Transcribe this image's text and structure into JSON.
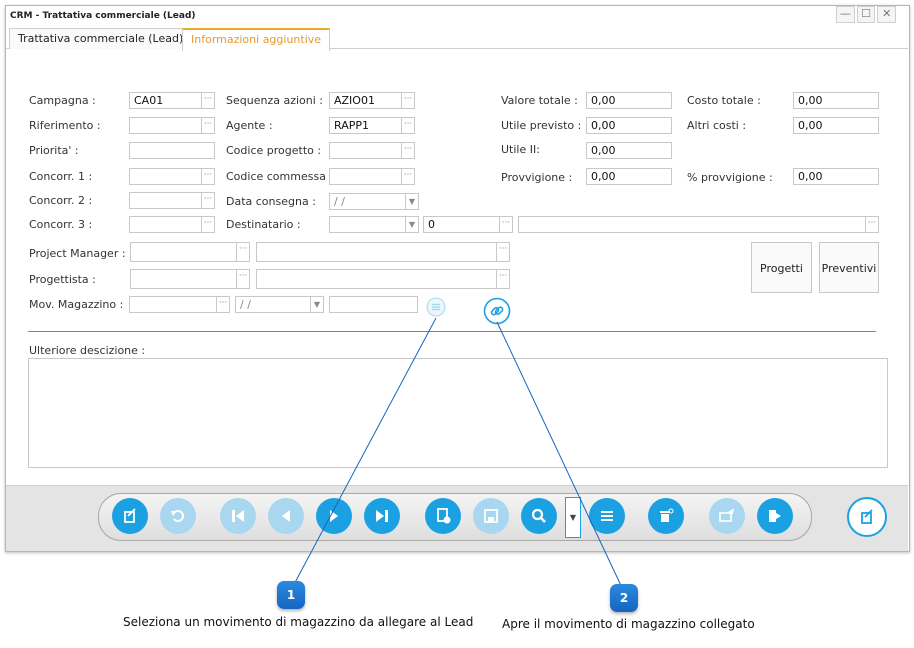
{
  "window": {
    "title": "CRM - Trattativa commerciale (Lead)",
    "controls": [
      "—",
      "☐",
      "✕"
    ]
  },
  "tabs": [
    {
      "label": "Trattativa commerciale (Lead)",
      "active": false
    },
    {
      "label": "Informazioni aggiuntive",
      "active": true
    }
  ],
  "form": {
    "campagna": {
      "label": "Campagna :",
      "value": "CA01"
    },
    "riferimento": {
      "label": "Riferimento :",
      "value": ""
    },
    "priorita": {
      "label": "Priorita' :",
      "value": ""
    },
    "concorr1": {
      "label": "Concorr. 1 :",
      "value": ""
    },
    "concorr2": {
      "label": "Concorr. 2 :",
      "value": ""
    },
    "concorr3": {
      "label": "Concorr. 3 :",
      "value": ""
    },
    "sequenza_azioni": {
      "label": "Sequenza azioni :",
      "value": "AZIO01"
    },
    "agente": {
      "label": "Agente :",
      "value": "RAPP1"
    },
    "codice_progetto": {
      "label": "Codice progetto :",
      "value": ""
    },
    "codice_commessa": {
      "label": "Codice commessa :",
      "value": ""
    },
    "data_consegna": {
      "label": "Data consegna :",
      "value": " /  /"
    },
    "destinatario": {
      "label": "Destinatario :",
      "value": "",
      "number": "0",
      "name": ""
    },
    "valore_totale": {
      "label": "Valore totale :",
      "value": "0,00"
    },
    "utile_previsto": {
      "label": "Utile previsto :",
      "value": "0,00"
    },
    "utile_ii": {
      "label": "Utile II:",
      "value": "0,00"
    },
    "provvigione": {
      "label": "Provvigione :",
      "value": "0,00"
    },
    "costo_totale": {
      "label": "Costo totale :",
      "value": "0,00"
    },
    "altri_costi": {
      "label": "Altri costi :",
      "value": "0,00"
    },
    "perc_provvigione": {
      "label": "% provvigione :",
      "value": "0,00"
    },
    "project_manager": {
      "label": "Project Manager :",
      "code": "",
      "name": ""
    },
    "progettista": {
      "label": "Progettista :",
      "code": "",
      "name": ""
    },
    "mov_magazzino": {
      "label": "Mov. Magazzino :",
      "code": "",
      "date": " /  /",
      "number": ""
    },
    "ulteriore_descrizione": {
      "label": "Ulteriore descizione :",
      "value": ""
    }
  },
  "buttons": {
    "progetti": "Progetti",
    "preventivi": "Preventivi",
    "dots": "···"
  },
  "toolbar": {
    "accent": "#1ba1e2",
    "items": [
      "edit-icon",
      "undo-icon",
      "first-icon",
      "prev-icon",
      "next-icon",
      "last-icon",
      "new-doc-icon",
      "save-icon",
      "search-icon",
      "list-icon",
      "delete-icon",
      "export-icon",
      "exit-icon",
      "new-record-icon"
    ]
  },
  "callouts": [
    {
      "number": "1",
      "text": "Seleziona un movimento di magazzino da allegare al Lead"
    },
    {
      "number": "2",
      "text": "Apre il movimento di magazzino collegato"
    }
  ]
}
